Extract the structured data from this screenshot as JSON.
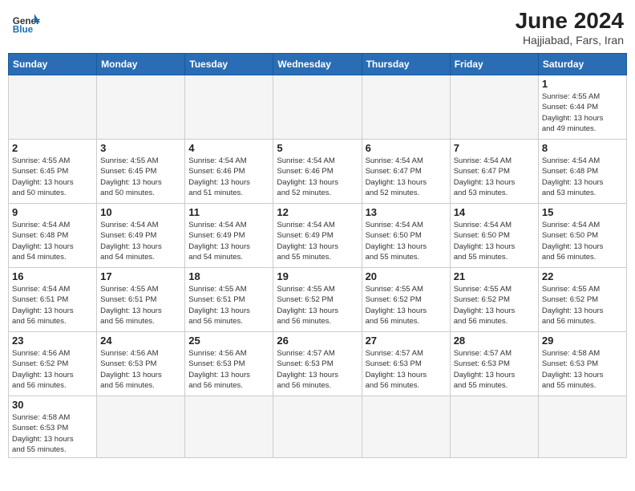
{
  "header": {
    "logo_general": "General",
    "logo_blue": "Blue",
    "month_year": "June 2024",
    "location": "Hajjiabad, Fars, Iran"
  },
  "weekdays": [
    "Sunday",
    "Monday",
    "Tuesday",
    "Wednesday",
    "Thursday",
    "Friday",
    "Saturday"
  ],
  "weeks": [
    [
      {
        "day": "",
        "info": ""
      },
      {
        "day": "",
        "info": ""
      },
      {
        "day": "",
        "info": ""
      },
      {
        "day": "",
        "info": ""
      },
      {
        "day": "",
        "info": ""
      },
      {
        "day": "",
        "info": ""
      },
      {
        "day": "1",
        "info": "Sunrise: 4:55 AM\nSunset: 6:44 PM\nDaylight: 13 hours\nand 49 minutes."
      }
    ],
    [
      {
        "day": "2",
        "info": "Sunrise: 4:55 AM\nSunset: 6:45 PM\nDaylight: 13 hours\nand 50 minutes."
      },
      {
        "day": "3",
        "info": "Sunrise: 4:55 AM\nSunset: 6:45 PM\nDaylight: 13 hours\nand 50 minutes."
      },
      {
        "day": "4",
        "info": "Sunrise: 4:54 AM\nSunset: 6:46 PM\nDaylight: 13 hours\nand 51 minutes."
      },
      {
        "day": "5",
        "info": "Sunrise: 4:54 AM\nSunset: 6:46 PM\nDaylight: 13 hours\nand 52 minutes."
      },
      {
        "day": "6",
        "info": "Sunrise: 4:54 AM\nSunset: 6:47 PM\nDaylight: 13 hours\nand 52 minutes."
      },
      {
        "day": "7",
        "info": "Sunrise: 4:54 AM\nSunset: 6:47 PM\nDaylight: 13 hours\nand 53 minutes."
      },
      {
        "day": "8",
        "info": "Sunrise: 4:54 AM\nSunset: 6:48 PM\nDaylight: 13 hours\nand 53 minutes."
      }
    ],
    [
      {
        "day": "9",
        "info": "Sunrise: 4:54 AM\nSunset: 6:48 PM\nDaylight: 13 hours\nand 54 minutes."
      },
      {
        "day": "10",
        "info": "Sunrise: 4:54 AM\nSunset: 6:49 PM\nDaylight: 13 hours\nand 54 minutes."
      },
      {
        "day": "11",
        "info": "Sunrise: 4:54 AM\nSunset: 6:49 PM\nDaylight: 13 hours\nand 54 minutes."
      },
      {
        "day": "12",
        "info": "Sunrise: 4:54 AM\nSunset: 6:49 PM\nDaylight: 13 hours\nand 55 minutes."
      },
      {
        "day": "13",
        "info": "Sunrise: 4:54 AM\nSunset: 6:50 PM\nDaylight: 13 hours\nand 55 minutes."
      },
      {
        "day": "14",
        "info": "Sunrise: 4:54 AM\nSunset: 6:50 PM\nDaylight: 13 hours\nand 55 minutes."
      },
      {
        "day": "15",
        "info": "Sunrise: 4:54 AM\nSunset: 6:50 PM\nDaylight: 13 hours\nand 56 minutes."
      }
    ],
    [
      {
        "day": "16",
        "info": "Sunrise: 4:54 AM\nSunset: 6:51 PM\nDaylight: 13 hours\nand 56 minutes."
      },
      {
        "day": "17",
        "info": "Sunrise: 4:55 AM\nSunset: 6:51 PM\nDaylight: 13 hours\nand 56 minutes."
      },
      {
        "day": "18",
        "info": "Sunrise: 4:55 AM\nSunset: 6:51 PM\nDaylight: 13 hours\nand 56 minutes."
      },
      {
        "day": "19",
        "info": "Sunrise: 4:55 AM\nSunset: 6:52 PM\nDaylight: 13 hours\nand 56 minutes."
      },
      {
        "day": "20",
        "info": "Sunrise: 4:55 AM\nSunset: 6:52 PM\nDaylight: 13 hours\nand 56 minutes."
      },
      {
        "day": "21",
        "info": "Sunrise: 4:55 AM\nSunset: 6:52 PM\nDaylight: 13 hours\nand 56 minutes."
      },
      {
        "day": "22",
        "info": "Sunrise: 4:55 AM\nSunset: 6:52 PM\nDaylight: 13 hours\nand 56 minutes."
      }
    ],
    [
      {
        "day": "23",
        "info": "Sunrise: 4:56 AM\nSunset: 6:52 PM\nDaylight: 13 hours\nand 56 minutes."
      },
      {
        "day": "24",
        "info": "Sunrise: 4:56 AM\nSunset: 6:53 PM\nDaylight: 13 hours\nand 56 minutes."
      },
      {
        "day": "25",
        "info": "Sunrise: 4:56 AM\nSunset: 6:53 PM\nDaylight: 13 hours\nand 56 minutes."
      },
      {
        "day": "26",
        "info": "Sunrise: 4:57 AM\nSunset: 6:53 PM\nDaylight: 13 hours\nand 56 minutes."
      },
      {
        "day": "27",
        "info": "Sunrise: 4:57 AM\nSunset: 6:53 PM\nDaylight: 13 hours\nand 56 minutes."
      },
      {
        "day": "28",
        "info": "Sunrise: 4:57 AM\nSunset: 6:53 PM\nDaylight: 13 hours\nand 55 minutes."
      },
      {
        "day": "29",
        "info": "Sunrise: 4:58 AM\nSunset: 6:53 PM\nDaylight: 13 hours\nand 55 minutes."
      }
    ],
    [
      {
        "day": "30",
        "info": "Sunrise: 4:58 AM\nSunset: 6:53 PM\nDaylight: 13 hours\nand 55 minutes."
      },
      {
        "day": "",
        "info": ""
      },
      {
        "day": "",
        "info": ""
      },
      {
        "day": "",
        "info": ""
      },
      {
        "day": "",
        "info": ""
      },
      {
        "day": "",
        "info": ""
      },
      {
        "day": "",
        "info": ""
      }
    ]
  ]
}
